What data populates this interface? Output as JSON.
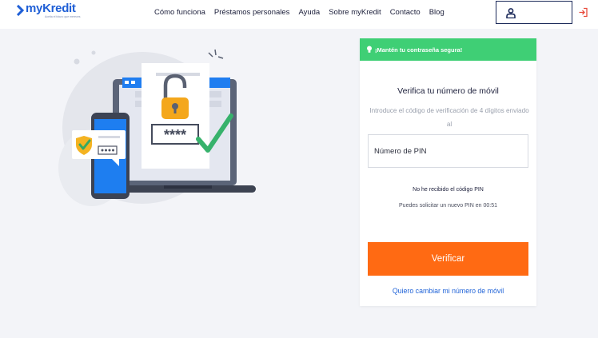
{
  "header": {
    "logo_text": "myKredit",
    "logo_tagline": "Aceita el futuro que mereces",
    "nav": [
      {
        "label": "Cómo funciona"
      },
      {
        "label": "Préstamos personales"
      },
      {
        "label": "Ayuda"
      },
      {
        "label": "Sobre myKredit"
      },
      {
        "label": "Contacto"
      },
      {
        "label": "Blog"
      }
    ],
    "account_icon": "user-icon",
    "login_icon": "sign-in-icon"
  },
  "illustration": {
    "pin_mask": "****",
    "icons": [
      "laptop-icon",
      "smartphone-icon",
      "padlock-icon",
      "shield-check-icon",
      "checkmark-icon"
    ]
  },
  "card": {
    "banner_text": "¡Mantén tu contraseña segura!",
    "banner_icon": "lightbulb-icon",
    "title": "Verifica tu número de móvil",
    "description": "Introduce el código de verificación de 4 dígitos enviado al",
    "pin_placeholder": "Número de PIN",
    "no_code_text": "No he recibido el código PIN",
    "resend_text": "Puedes solicitar un nuevo PIN en 00:51",
    "verify_button": "Verificar",
    "change_link": "Quiero cambiar mi número de móvil"
  },
  "colors": {
    "brand_blue": "#1f5fd6",
    "banner_green": "#3fcf75",
    "button_orange": "#ff6a13",
    "link_blue": "#2164d8",
    "navy": "#1c2a5a"
  }
}
